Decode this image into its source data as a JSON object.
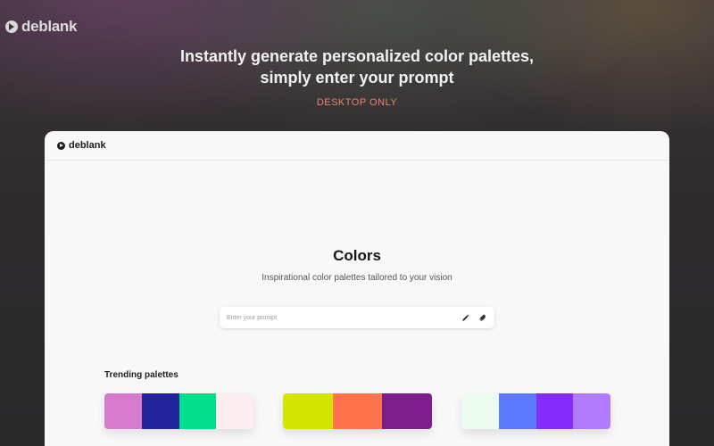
{
  "brand": {
    "name": "deblank"
  },
  "hero": {
    "line1": "Instantly generate personalized color palettes,",
    "line2": "simply enter your prompt",
    "badge": "DESKTOP ONLY"
  },
  "app": {
    "logo_text": "deblank",
    "title": "Colors",
    "subtitle": "Inspirational color palettes tailored to your vision",
    "prompt": {
      "placeholder": "Enter your prompt",
      "value": "",
      "icons": [
        "pen-icon",
        "paperclip-icon"
      ]
    },
    "trending": {
      "label": "Trending palettes",
      "palettes": [
        {
          "colors": [
            "#D87ACB",
            "#23239A",
            "#00DF8C",
            "#FCEEF0"
          ]
        },
        {
          "colors": [
            "#D4E600",
            "#FF744C",
            "#7E1E8C"
          ]
        },
        {
          "colors": [
            "#EDFCF0",
            "#5C79FF",
            "#852CFF",
            "#B07BFF"
          ]
        }
      ]
    }
  },
  "colors": {
    "accent": "#E8866A",
    "card_bg": "#F8F8F8"
  }
}
